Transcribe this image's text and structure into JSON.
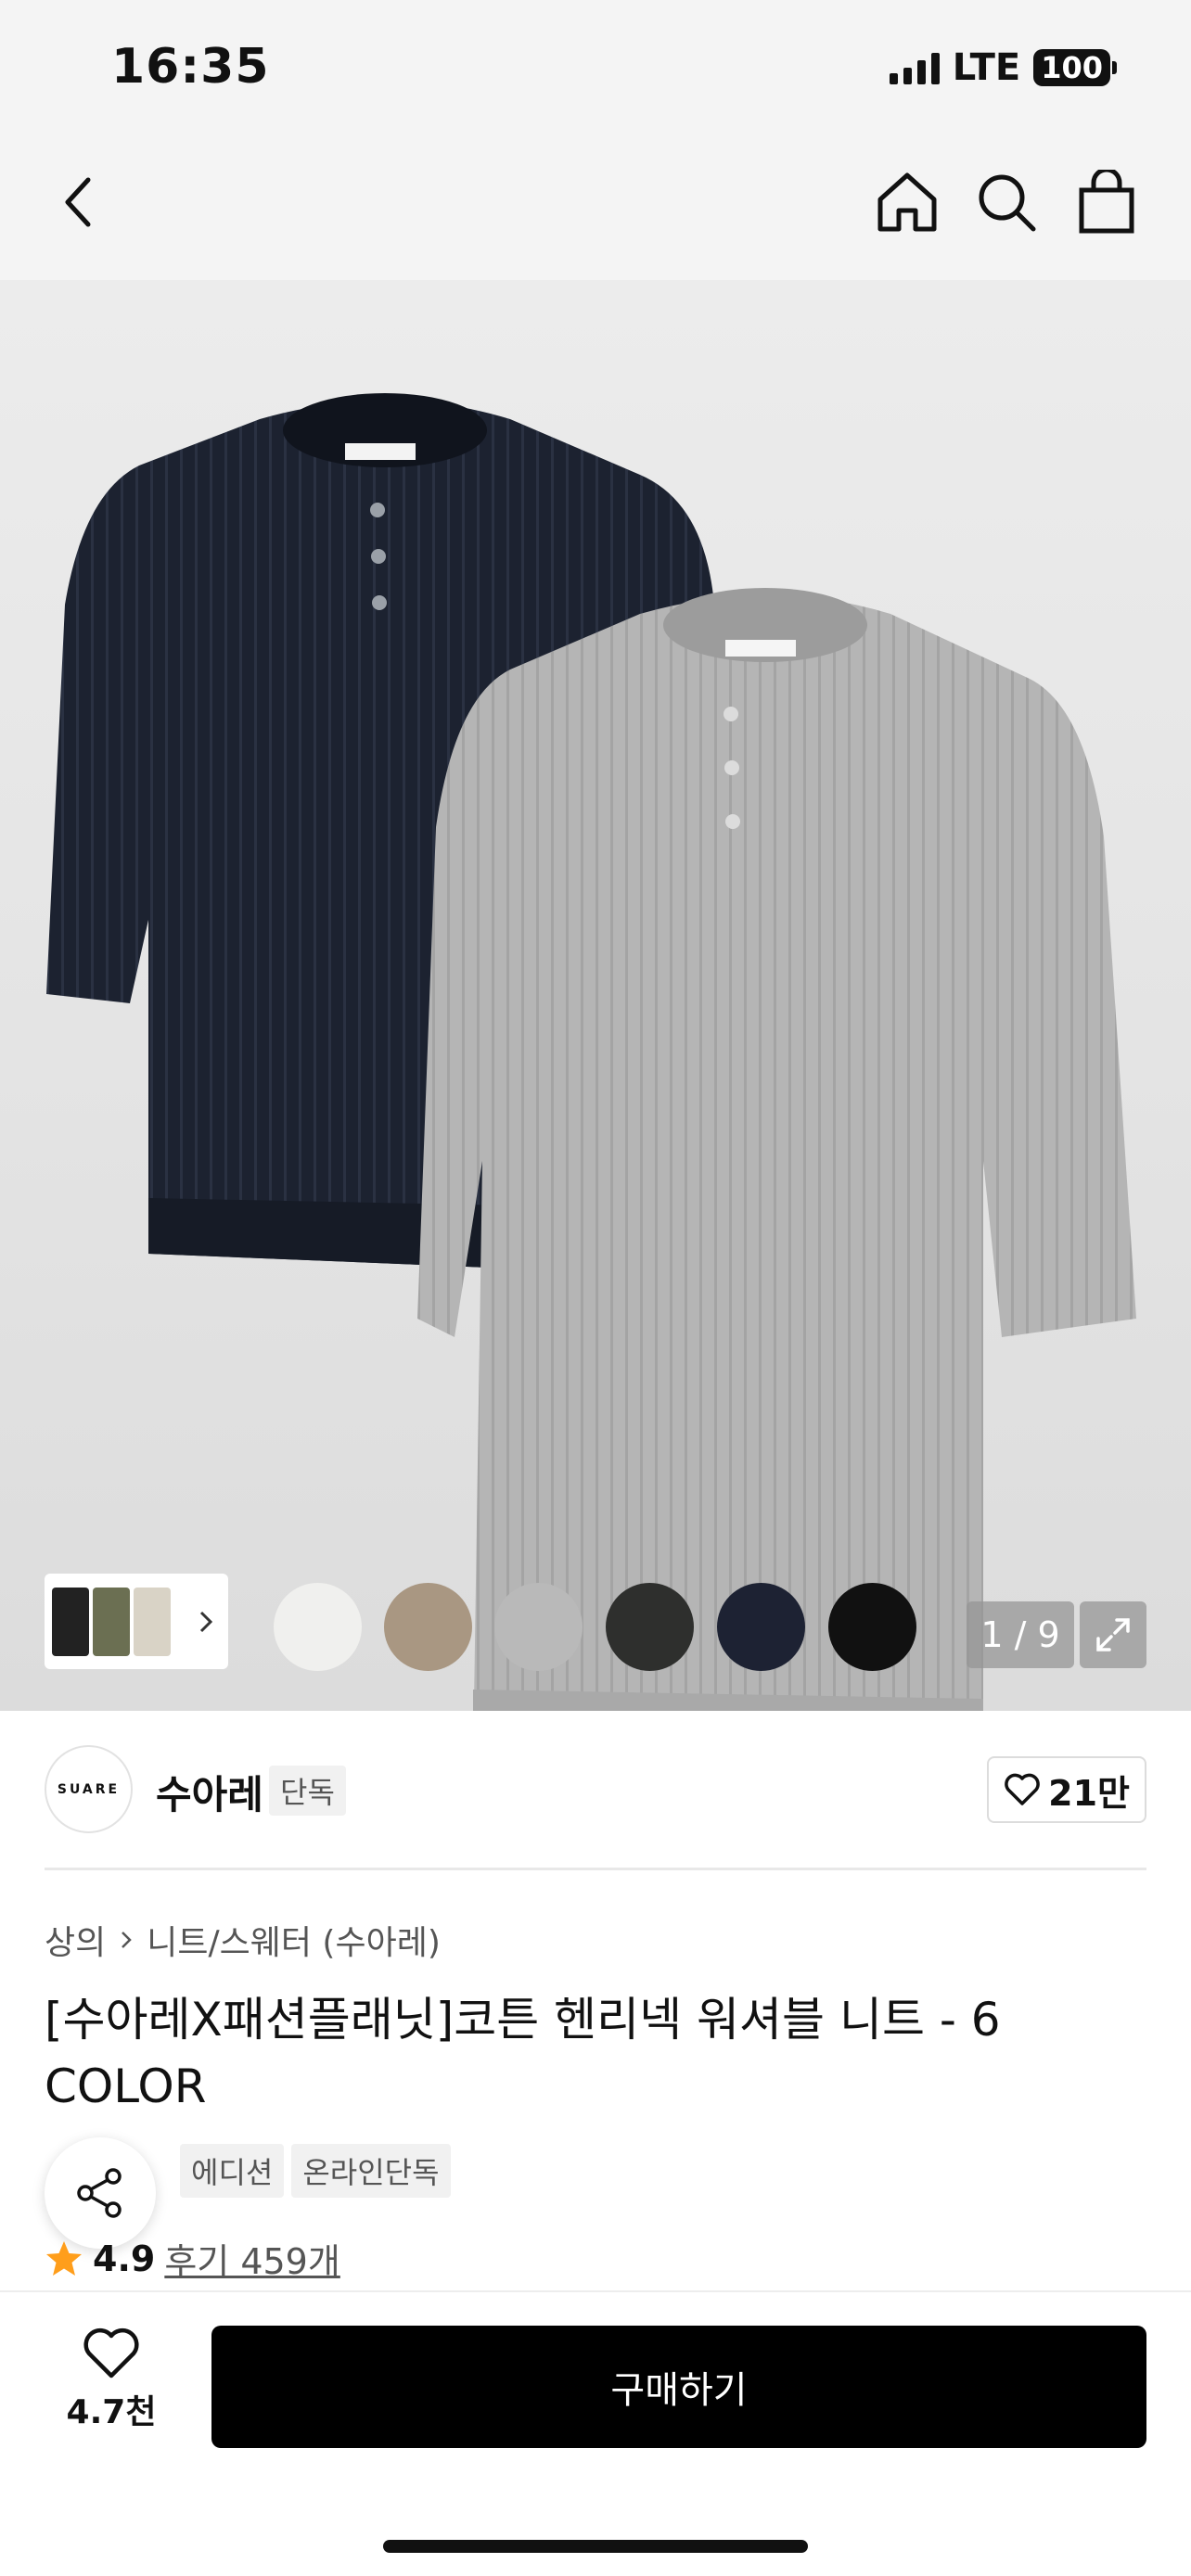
{
  "status_bar": {
    "time": "16:35",
    "network": "LTE",
    "battery": "100"
  },
  "gallery": {
    "swatches": [
      "#f0f0ee",
      "#a99782",
      "#b9b9b9",
      "#2e2f2d",
      "#1d2233",
      "#111111"
    ],
    "page_counter": "1 / 9"
  },
  "brand": {
    "logo_text": "SUARE",
    "name": "수아레",
    "tag": "단독",
    "likes": "21만"
  },
  "breadcrumb": {
    "root": "상의",
    "category": "니트/스웨터 (수아레)"
  },
  "product": {
    "title": "[수아레X패션플래닛]코튼 헨리넥 워셔블 니트 - 6 COLOR",
    "badges": [
      "에디션",
      "온라인단독"
    ],
    "rating": "4.9",
    "reviews": "후기 459개"
  },
  "bottom_bar": {
    "wish_count": "4.7천",
    "buy_label": "구매하기"
  }
}
